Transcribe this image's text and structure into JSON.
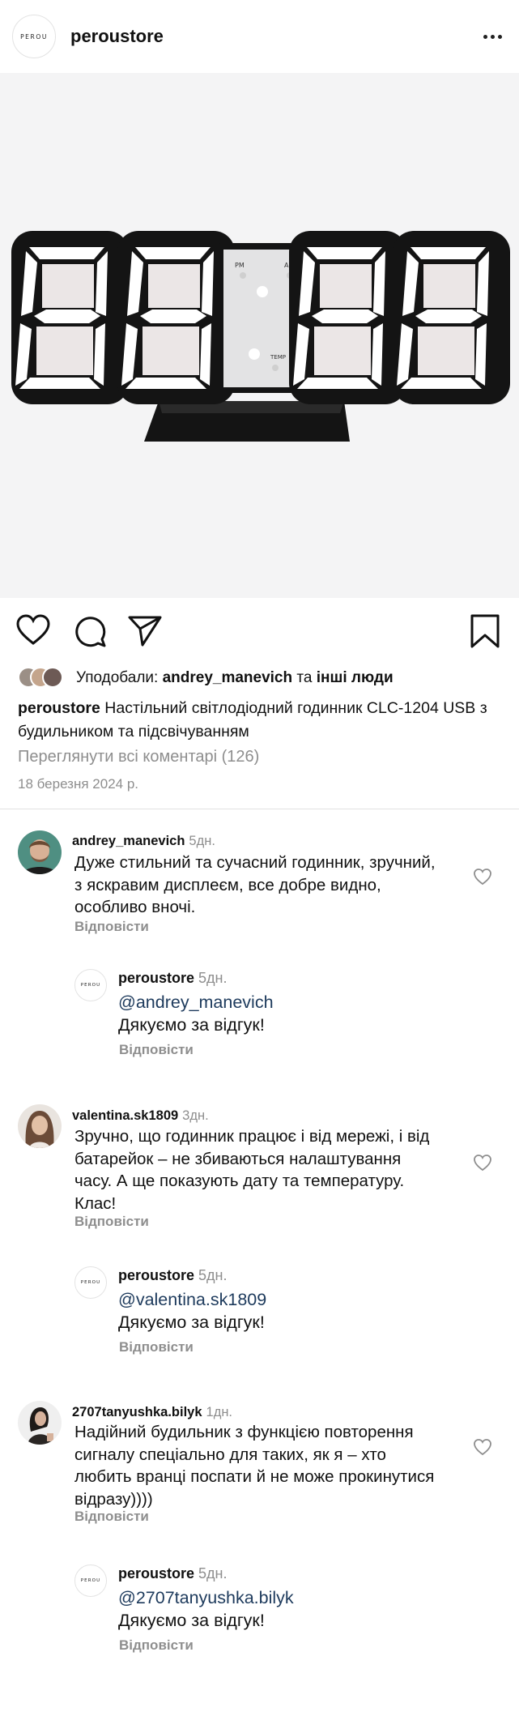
{
  "header": {
    "logo_text": "PEROU",
    "username": "peroustore",
    "more_icon": "more-dots-icon"
  },
  "post": {
    "image_subject": "clock-display-image",
    "clock_labels": {
      "pm": "PM",
      "al": "AL",
      "temp": "TEMP"
    },
    "actions": {
      "like_icon": "heart-icon",
      "comment_icon": "comment-icon",
      "share_icon": "send-icon",
      "save_icon": "bookmark-icon"
    },
    "likes": {
      "prefix": "Уподобали: ",
      "user": "andrey_manevich",
      "middle": " та ",
      "others": "інші люди"
    },
    "caption": {
      "user": "peroustore",
      "text": " Настільний світлодіодний годинник CLC-1204 USB з будильником та підсвічуванням"
    },
    "view_all_comments": "Переглянути всі коментарі (126)",
    "date": "18 березня 2024 р."
  },
  "comments": [
    {
      "user": "andrey_manevich",
      "time": "5дн.",
      "text": "Дуже стильний та сучасний годинник, зручний, з яскравим дисплеєм, все добре видно, особливо вночі.",
      "reply_label": "Відповісти",
      "reply": {
        "user": "peroustore",
        "time": "5дн.",
        "mention": "@andrey_manevich",
        "text": "Дякуємо за відгук!",
        "reply_label": "Відповісти"
      }
    },
    {
      "user": "valentina.sk1809",
      "time": "3дн.",
      "text": "Зручно, що годинник працює і від мережі, і від батарейок – не збиваються налаштування часу. А ще показують дату та температуру. Клас!",
      "reply_label": "Відповісти",
      "reply": {
        "user": "peroustore",
        "time": "5дн.",
        "mention": "@valentina.sk1809",
        "text": "Дякуємо за відгук!",
        "reply_label": "Відповісти"
      }
    },
    {
      "user": "2707tanyushka.bilyk",
      "time": "1дн.",
      "text": "Надійний будильник з функцією повторення сигналу спеціально для таких, як я – хто любить вранці поспати й не може прокинутися відразу))))",
      "reply_label": "Відповісти",
      "reply": {
        "user": "peroustore",
        "time": "5дн.",
        "mention": "@2707tanyushka.bilyk",
        "text": "Дякуємо за відгук!",
        "reply_label": "Відповісти"
      }
    }
  ]
}
